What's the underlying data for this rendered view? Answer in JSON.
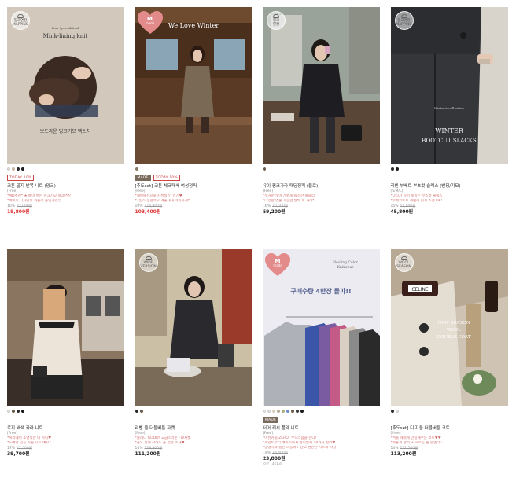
{
  "products": [
    {
      "badge": "핑크연캉\nMAPPING",
      "image": {
        "caption_en": "Mink-lining knit",
        "caption_small": "Lins Specialitical",
        "caption_ko": "보드라운 밍크기모 맥스처"
      },
      "swatches": [
        "#e8dfd4",
        "#c9b8a2",
        "#2b2b2b",
        "#1a1a1a"
      ],
      "tags": [
        "TODAY 10%"
      ],
      "name": "코튼 골지 반목 니트 (밍크)",
      "size": "[Free]",
      "desc": [
        "*MD추천* ★ 베이 특한 밍크기모 핑크연캉",
        "*베이직 디자인의 커플러 돌입가인☺"
      ],
      "discount": "10%",
      "original_price": "22,000원",
      "price": "19,800원",
      "price_red": true
    },
    {
      "badge": "M\nmade",
      "image": {
        "caption_en": "We Love Winter"
      },
      "swatches": [
        "#8b7a66"
      ],
      "tags": [
        "MADE",
        "TODAY 10%"
      ],
      "name": "[추도set] 코튼 체크패쎄 여성정퍼",
      "size": "[Free]",
      "desc": [
        "*세련패션으로 감성적 인 인기♥",
        "*2인스 증한적모 겨울내내 따뜻하게*"
      ],
      "discount": "10%",
      "original_price": "114,900원",
      "price": "103,400원",
      "price_red": true
    },
    {
      "badge": "핑크\n연캉",
      "image": {},
      "swatches": [
        "#6b5a48"
      ],
      "tags": [],
      "name": "유이 핑크가라 패딩정퍼 (블로)",
      "size": "[Free]",
      "desc": [
        "*무거운 많이 가볍게 따스한 볼륨☺",
        "*다양한 연출 가능한 날짝 퍼 가리*"
      ],
      "discount": "16%",
      "original_price": "70,500원",
      "price": "59,200원",
      "price_red": false
    },
    {
      "badge": "핑크연캉\nMAPPING",
      "image": {
        "caption_small": "Winter's collection",
        "caption_en": "WINTER\nBOOTCUT SLACKS"
      },
      "swatches": [
        "#2b2b2b",
        "#1a1a1a"
      ],
      "tags": [],
      "name": "리벤 부베트 부츠컷 슬랙스 (밴딩/기모)",
      "size": "[S/M/L]",
      "desc": [
        "*다리가 길어 보이는 부츠컷 슬랙스",
        "*부베코트로 세련해 핏게 조정 OK!"
      ],
      "discount": "15%",
      "original_price": "54,000원",
      "price": "45,800원",
      "price_red": false
    },
    {
      "badge": "",
      "image": {},
      "swatches": [
        "#e8dfd4",
        "#6b5a48",
        "#2b2b2b",
        "#1a1a1a"
      ],
      "tags": [],
      "name": "로지 배색 카라 니트",
      "size": "[Free]",
      "desc": [
        "*피리에어 조면적한 나 가디♥",
        "*도매당 있는 가을 니트 예요♪"
      ],
      "discount": "17%",
      "original_price": "47,500원",
      "price": "39,700원",
      "price_red": false
    },
    {
      "badge": "WIDE\nVERSION",
      "image": {},
      "swatches": [
        "#2b2b2b",
        "#6b5a48"
      ],
      "tags": [],
      "name": "리벤 울 더블버튼 자켓",
      "size": "[Free]",
      "desc": [
        "*클리디 GOOD! 고급스러운 FW자켓",
        "*울도 함께 착해도 울 젖은 소재♥"
      ],
      "discount": "14%",
      "original_price": "129,900원",
      "price": "111,200원",
      "price_red": false
    },
    {
      "badge": "M\nmade",
      "image": {
        "caption_small": "Healing Color\nKnitwear",
        "caption_ko": "구매수량 4만장 돌파!!"
      },
      "swatches": [
        "#f0ece6",
        "#e8dfd4",
        "#d9cfc2",
        "#b6a998",
        "#a8b07a",
        "#6c8ccf",
        "#6b5a48",
        "#3a3a3a",
        "#1a1a1a"
      ],
      "tags": [
        "MADE"
      ],
      "name": "더어 캐시 플라 니트",
      "size": "[Free]",
      "desc": [
        "*마슈카릴 ZERO! 부드러움을 한다!",
        "*포인트부터 베이직까지 팔리일지 18가지 컬러♥",
        "*망양시작 일진 더블버+ 남고 편한한 사트라 파장"
      ],
      "discount": "19%",
      "original_price": "29,400원",
      "price": "23,800원",
      "price_red": false,
      "review": "리뷰 (3213)"
    },
    {
      "badge": "WOOL\nSEASON",
      "image": {
        "caption_en": "NEW SEASON\nWOOL\nDOUBLE COAT",
        "caption_brand": "CELINE"
      },
      "swatches": [
        "#2b2b2b",
        "#e8dfd4"
      ],
      "tags": [],
      "name": "[추도set] 디프 울 더블버튼 코트",
      "size": "[Free]",
      "desc": [
        "*겨울 해워게 만중해주는 코트♥♥",
        "*겨울겨 한적 + 흐르는 울 몸엔터♡"
      ],
      "discount": "14%",
      "original_price": "131,500원",
      "price": "113,200원",
      "price_red": false
    }
  ],
  "colors": {
    "discount_red": "#d33333",
    "desc_pink": "#d36f6f",
    "made_tag": "#7a6a5c"
  }
}
